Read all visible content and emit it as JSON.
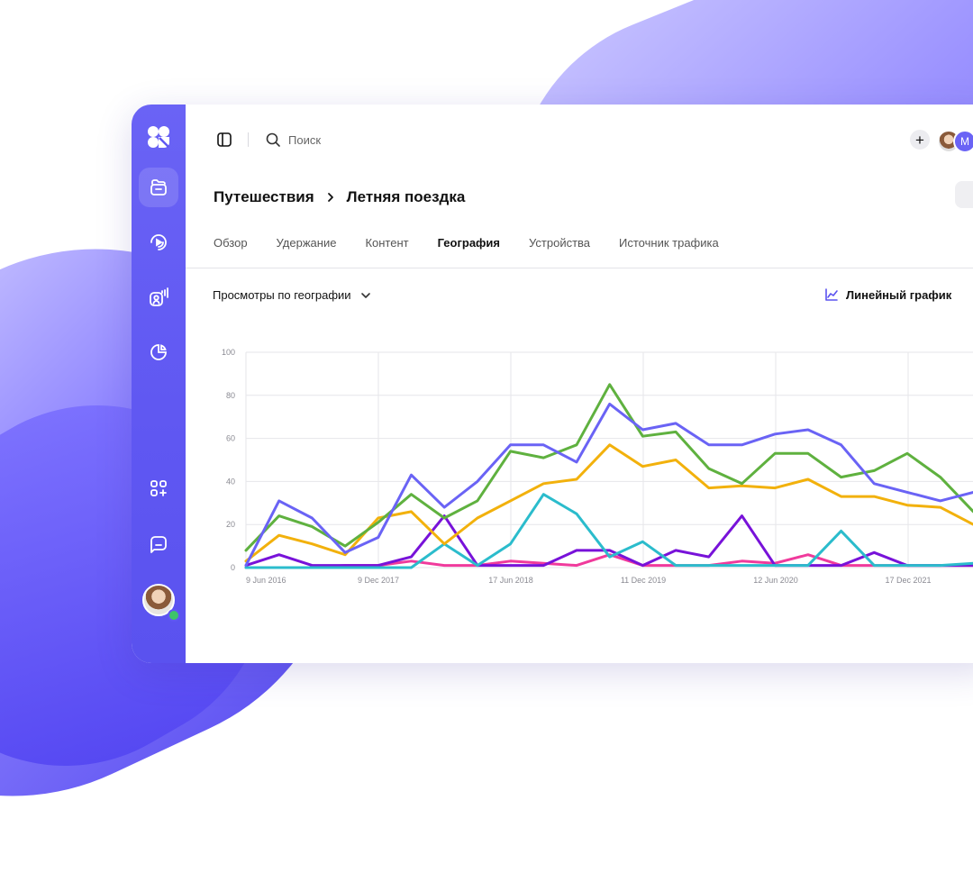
{
  "colors": {
    "accent": "#6a63f5",
    "series": [
      "#6a63f5",
      "#5fb13f",
      "#f2b10c",
      "#2bbccc",
      "#7812d9",
      "#f03a9c"
    ]
  },
  "sidebar": {
    "items": [
      {
        "icon": "folder-icon",
        "active": true
      },
      {
        "icon": "broadcast-icon",
        "active": false
      },
      {
        "icon": "contact-analytics-icon",
        "active": false
      },
      {
        "icon": "pie-chart-icon",
        "active": false
      },
      {
        "icon": "apps-add-icon",
        "active": false
      },
      {
        "icon": "chat-icon",
        "active": false
      }
    ]
  },
  "topbar": {
    "search_placeholder": "Поиск",
    "avatar_initial": "M",
    "add_label": "+"
  },
  "breadcrumb": {
    "parent": "Путешествия",
    "current": "Летняя поездка"
  },
  "tabs": [
    {
      "label": "Обзор",
      "active": false
    },
    {
      "label": "Удержание",
      "active": false
    },
    {
      "label": "Контент",
      "active": false
    },
    {
      "label": "География",
      "active": true
    },
    {
      "label": "Устройства",
      "active": false
    },
    {
      "label": "Источник трафика",
      "active": false
    }
  ],
  "controls": {
    "metric_label": "Просмотры по географии",
    "chart_type_label": "Линейный график"
  },
  "chart_data": {
    "type": "line",
    "title": "",
    "xlabel": "",
    "ylabel": "",
    "ylim": [
      0,
      100
    ],
    "yticks": [
      0,
      20,
      40,
      60,
      80,
      100
    ],
    "xtick_labels": [
      "9 Jun 2016",
      "9 Dec 2017",
      "17 Jun 2018",
      "11 Dec 2019",
      "12 Jun 2020",
      "17 Dec 2021"
    ],
    "grid": true,
    "series": [
      {
        "values": [
          1,
          31,
          23,
          7,
          14,
          43,
          28,
          40,
          57,
          57,
          49,
          76,
          64,
          67,
          57,
          57,
          62,
          64,
          57,
          39,
          35,
          31,
          35
        ]
      },
      {
        "values": [
          8,
          24,
          19,
          10,
          21,
          34,
          23,
          31,
          54,
          51,
          57,
          85,
          61,
          63,
          46,
          39,
          53,
          53,
          42,
          45,
          53,
          42,
          26
        ]
      },
      {
        "values": [
          3,
          15,
          11,
          6,
          23,
          26,
          11,
          23,
          31,
          39,
          41,
          57,
          47,
          50,
          37,
          38,
          37,
          41,
          33,
          33,
          29,
          28,
          20
        ]
      },
      {
        "values": [
          0,
          0,
          0,
          0,
          0,
          0,
          11,
          1,
          11,
          34,
          25,
          5,
          12,
          1,
          1,
          1,
          1,
          1,
          17,
          1,
          1,
          1,
          2
        ]
      },
      {
        "values": [
          1,
          6,
          1,
          1,
          1,
          5,
          24,
          1,
          1,
          1,
          8,
          8,
          1,
          8,
          5,
          24,
          1,
          1,
          1,
          7,
          1,
          1,
          1
        ]
      },
      {
        "values": [
          0,
          0,
          0,
          1,
          1,
          3,
          1,
          1,
          3,
          2,
          1,
          6,
          1,
          1,
          1,
          3,
          2,
          6,
          1,
          1,
          1,
          1,
          1
        ]
      }
    ]
  }
}
